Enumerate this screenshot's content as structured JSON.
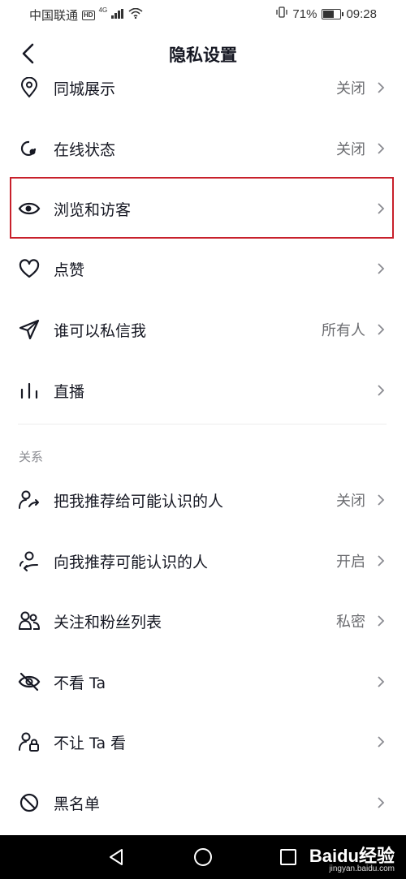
{
  "status_bar": {
    "carrier": "中国联通",
    "hd": "HD",
    "network": "4G",
    "battery_percent": "71%",
    "battery_level": 0.71,
    "time": "09:28"
  },
  "header": {
    "title": "隐私设置"
  },
  "rows": [
    {
      "label": "同城展示",
      "value": "关闭",
      "icon": "location-pin-icon"
    },
    {
      "label": "在线状态",
      "value": "关闭",
      "icon": "online-status-icon"
    },
    {
      "label": "浏览和访客",
      "value": "",
      "icon": "eye-icon"
    },
    {
      "label": "点赞",
      "value": "",
      "icon": "heart-icon"
    },
    {
      "label": "谁可以私信我",
      "value": "所有人",
      "icon": "send-icon"
    },
    {
      "label": "直播",
      "value": "",
      "icon": "live-bars-icon"
    }
  ],
  "relation_section": {
    "title": "关系",
    "rows": [
      {
        "label": "把我推荐给可能认识的人",
        "value": "关闭",
        "icon": "user-share-icon"
      },
      {
        "label": "向我推荐可能认识的人",
        "value": "开启",
        "icon": "user-recommend-icon"
      },
      {
        "label": "关注和粉丝列表",
        "value": "私密",
        "icon": "users-icon"
      },
      {
        "label": "不看 Ta",
        "value": "",
        "icon": "eye-off-icon"
      },
      {
        "label": "不让 Ta 看",
        "value": "",
        "icon": "user-lock-icon"
      },
      {
        "label": "黑名单",
        "value": "",
        "icon": "block-icon"
      }
    ]
  },
  "watermark": {
    "text": "Baidu经验",
    "sub": "jingyan.baidu.com"
  },
  "colors": {
    "highlight": "#c8202b",
    "value_text": "#6b6c70",
    "section_text": "#8a8b91"
  }
}
